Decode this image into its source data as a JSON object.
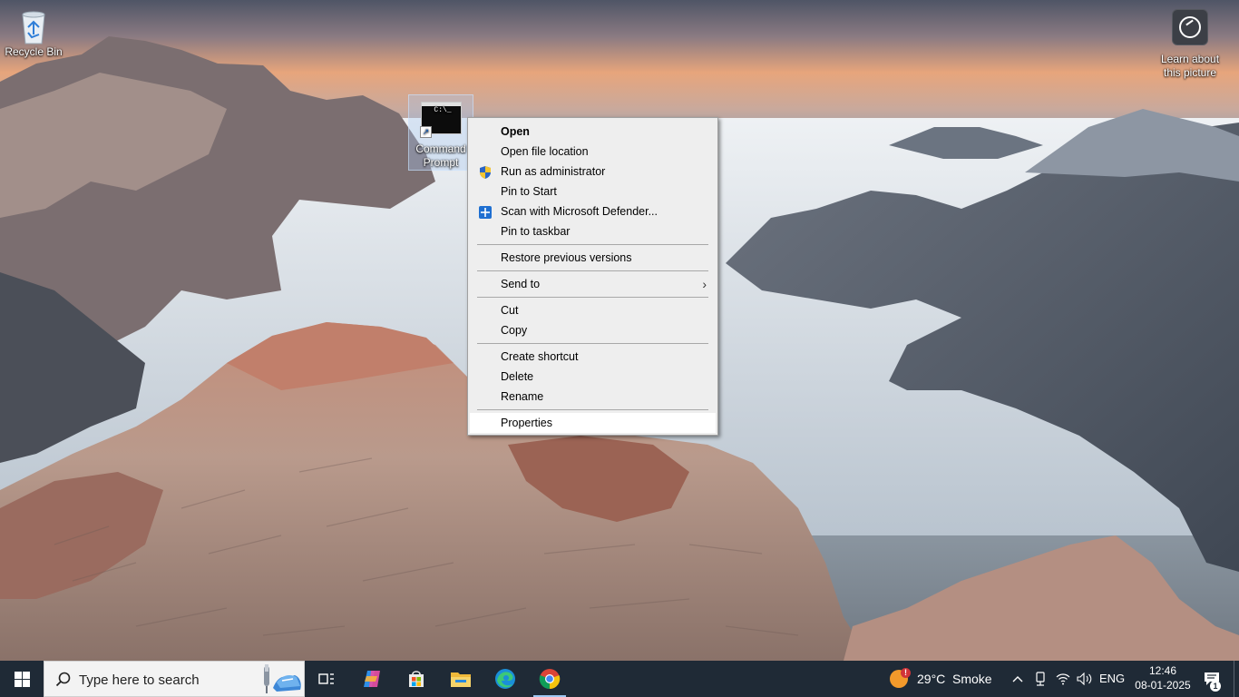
{
  "desktop": {
    "icons": [
      {
        "label": "Recycle Bin",
        "icon": "recycle-bin-icon"
      },
      {
        "label_line1": "Command",
        "label_line2": "Prompt",
        "icon": "command-prompt-icon"
      }
    ],
    "learn_about": {
      "line1": "Learn about",
      "line2": "this picture",
      "icon": "camera-icon"
    },
    "cmd_icon_text": "C:\\_"
  },
  "context_menu": {
    "items": [
      {
        "label": "Open",
        "bold": true
      },
      {
        "label": "Open file location"
      },
      {
        "label": "Run as administrator",
        "icon": "uac-shield-icon"
      },
      {
        "label": "Pin to Start"
      },
      {
        "label": "Scan with Microsoft Defender...",
        "icon": "defender-icon"
      },
      {
        "label": "Pin to taskbar"
      },
      {
        "label": "Restore previous versions"
      },
      {
        "label": "Send to",
        "submenu": true
      },
      {
        "label": "Cut"
      },
      {
        "label": "Copy"
      },
      {
        "label": "Create shortcut"
      },
      {
        "label": "Delete"
      },
      {
        "label": "Rename"
      },
      {
        "label": "Properties",
        "highlighted": true
      }
    ]
  },
  "taskbar": {
    "search_placeholder": "Type here to search",
    "apps": [
      "task-view-icon",
      "copilot-icon",
      "microsoft-store-icon",
      "file-explorer-icon",
      "edge-icon",
      "chrome-icon"
    ],
    "weather": {
      "temp": "29°C",
      "condition": "Smoke",
      "alert": "!"
    },
    "language": "ENG",
    "time": "12:46",
    "date": "08-01-2025",
    "notifications": "1"
  },
  "colors": {
    "taskbar": "#1f2a36",
    "menu_bg": "#eeeeee",
    "accent": "#9ec7f2"
  }
}
